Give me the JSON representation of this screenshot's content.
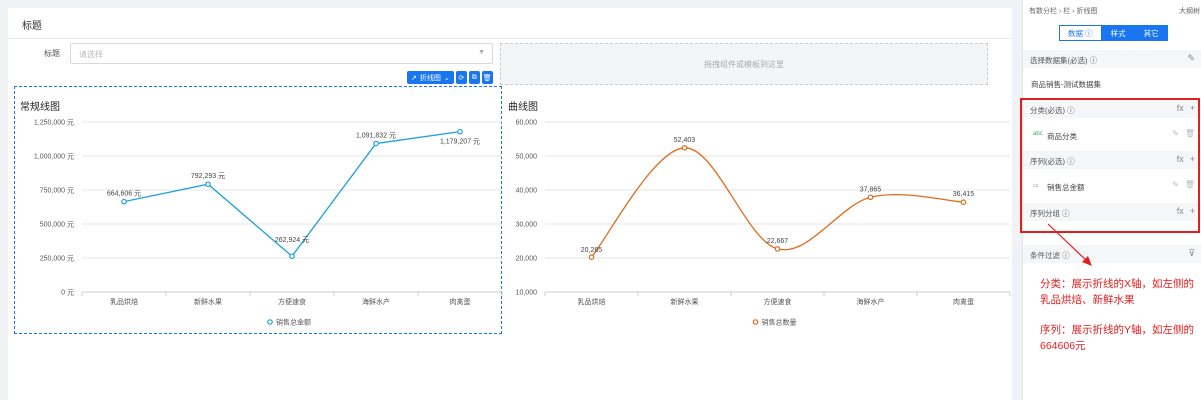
{
  "page": {
    "title": "标题"
  },
  "filter": {
    "label": "标题",
    "placeholder": "请选择"
  },
  "drop_zone": {
    "text": "拖拽组件或模板到这里"
  },
  "toolbar": {
    "chart_type_label": "折线图"
  },
  "colors": {
    "line1": "#1a9fe0",
    "line2": "#e06a1a",
    "accent": "#1976f0",
    "annotation": "#e02020"
  },
  "chart_data": [
    {
      "type": "line",
      "title": "常规线图",
      "categories": [
        "乳品烘焙",
        "新鲜水果",
        "方便速食",
        "海鲜水产",
        "肉禽蛋"
      ],
      "series": [
        {
          "name": "销售总金额",
          "values": [
            664606,
            792293,
            262924,
            1091832,
            1179207
          ]
        }
      ],
      "data_labels": [
        "664,606 元",
        "792,293 元",
        "262,924 元",
        "1,091,832 元",
        "1,179,207 元"
      ],
      "yticks": [
        "0 元",
        "250,000 元",
        "500,000 元",
        "750,000 元",
        "1,000,000 元",
        "1,250,000 元"
      ],
      "ylim": [
        0,
        1250000
      ],
      "smooth": false,
      "grid": true,
      "legend": "bottom-center"
    },
    {
      "type": "line",
      "title": "曲线图",
      "categories": [
        "乳品烘焙",
        "新鲜水果",
        "方便速食",
        "海鲜水产",
        "肉禽蛋"
      ],
      "series": [
        {
          "name": "销售总数量",
          "values": [
            20265,
            52403,
            22667,
            37865,
            36415
          ]
        }
      ],
      "data_labels": [
        "20,265",
        "52,403",
        "22,667",
        "37,865",
        "36,415"
      ],
      "yticks": [
        "10,000",
        "20,000",
        "30,000",
        "40,000",
        "50,000",
        "60,000"
      ],
      "ylim": [
        10000,
        60000
      ],
      "smooth": true,
      "grid": true,
      "legend": "bottom-center"
    }
  ],
  "panel": {
    "breadcrumb": "有数分栏 › 栏 › 折线图",
    "right_label": "大纲树",
    "tabs": [
      {
        "label": "数据 ⓘ",
        "active": false
      },
      {
        "label": "样式",
        "active": true
      },
      {
        "label": "其它",
        "active": true
      }
    ],
    "dataset_section": "选择数据集(必选) ⓘ",
    "dataset_name": "商品销售-测试数据集",
    "category_section": "分类(必选) ⓘ",
    "category_field": "商品分类",
    "category_field_icon": "abc",
    "series_section": "序列(必选) ⓘ",
    "series_field": "销售总金额",
    "series_group_section": "序列分组 ⓘ",
    "filter_section": "条件过滤 ⓘ",
    "fx": "fx",
    "plus": "+"
  },
  "annotations": {
    "category_note": "分类：展示折线的X轴，如左侧的乳品烘焙、新鲜水果",
    "series_note": "序列：展示折线的Y轴，如左侧的664606元"
  }
}
